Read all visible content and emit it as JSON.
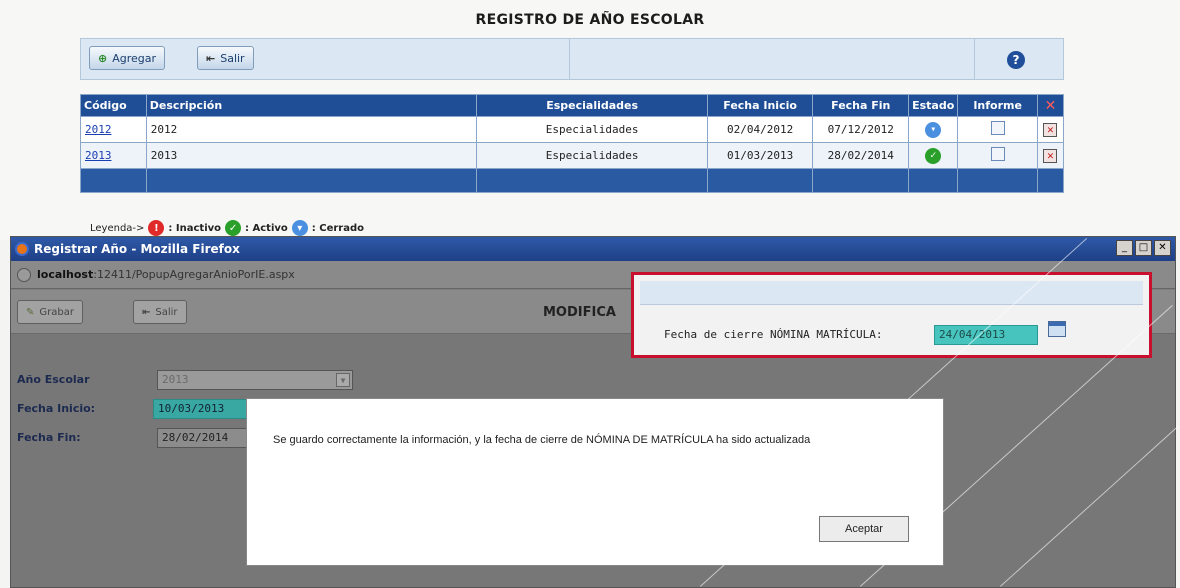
{
  "page": {
    "title": "REGISTRO DE AÑO ESCOLAR"
  },
  "toolbar": {
    "add_label": "Agregar",
    "exit_label": "Salir",
    "help_label": "?"
  },
  "table": {
    "headers": [
      "Código",
      "Descripción",
      "Especialidades",
      "Fecha Inicio",
      "Fecha Fin",
      "Estado",
      "Informe",
      "✕"
    ],
    "rows": [
      {
        "code": "2012",
        "description": "2012",
        "specialties": "Especialidades",
        "start": "02/04/2012",
        "end": "07/12/2012",
        "status": "Cerrado"
      },
      {
        "code": "2013",
        "description": "2013",
        "specialties": "Especialidades",
        "start": "01/03/2013",
        "end": "28/02/2014",
        "status": "Activo"
      }
    ]
  },
  "legend": {
    "prefix": "Leyenda->",
    "inactive": ": Inactivo",
    "active": ": Activo",
    "closed": ": Cerrado"
  },
  "popup": {
    "window_title": "Registrar Año - Mozilla Firefox",
    "url_host": "localhost",
    "url_rest": ":12411/PopupAgregarAnioPorIE.aspx",
    "save_label": "Grabar",
    "exit_label": "Salir",
    "mode_label": "MODIFICA",
    "form": {
      "year_label": "Año Escolar",
      "year_value": "2013",
      "start_label": "Fecha Inicio:",
      "start_value": "10/03/2013",
      "end_label": "Fecha Fin:",
      "end_value": "28/02/2014"
    },
    "highlight": {
      "label": "Fecha de cierre NÓMINA MATRÍCULA:",
      "value": "24/04/2013"
    },
    "dialog": {
      "message": "Se guardo correctamente la información, y la fecha de cierre de NÓMINA DE MATRÍCULA ha sido actualizada",
      "ok_label": "Aceptar"
    }
  },
  "colors": {
    "header_blue": "#1f4e96",
    "highlight_red": "#c8102e",
    "teal": "#48c4be"
  }
}
